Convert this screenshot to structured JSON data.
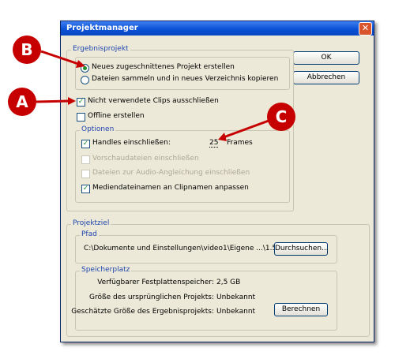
{
  "window": {
    "title": "Projektmanager",
    "close_glyph": "✕"
  },
  "buttons": {
    "ok": "OK",
    "cancel": "Abbrechen",
    "browse": "Durchsuchen...",
    "calculate": "Berechnen"
  },
  "result_project": {
    "legend": "Ergebnisprojekt",
    "options": [
      {
        "label": "Neues zugeschnittenes Projekt erstellen",
        "selected": true
      },
      {
        "label": "Dateien sammeln und in neues Verzeichnis kopieren",
        "selected": false
      }
    ],
    "exclude_unused": {
      "label": "Nicht verwendete Clips ausschließen",
      "checked": true
    },
    "offline": {
      "label": "Offline erstellen",
      "checked": false
    },
    "options_group": {
      "legend": "Optionen",
      "handles": {
        "label": "Handles einschließen:",
        "checked": true,
        "value": "25",
        "unit": "Frames"
      },
      "preview": {
        "label": "Vorschaudateien einschließen",
        "checked": false,
        "disabled": true
      },
      "audio": {
        "label": "Dateien zur Audio-Angleichung einschließen",
        "checked": false,
        "disabled": true
      },
      "rename": {
        "label": "Mediendateinamen an Clipnamen anpassen",
        "checked": true
      }
    }
  },
  "project_target": {
    "legend": "Projektziel",
    "path": {
      "legend": "Pfad",
      "value": "C:\\Dokumente und Einstellungen\\video1\\Eigene ...\\1.5"
    },
    "storage": {
      "legend": "Speicherplatz",
      "free_label": "Verfügbarer Festplattenspeicher:",
      "free_value": "2,5 GB",
      "orig_label": "Größe des ursprünglichen Projekts:",
      "orig_value": "Unbekannt",
      "est_label": "Geschätzte Größe des Ergebnisprojekts:",
      "est_value": "Unbekannt"
    }
  },
  "annotations": {
    "a": "A",
    "b": "B",
    "c": "C",
    "color": "#c60000"
  }
}
